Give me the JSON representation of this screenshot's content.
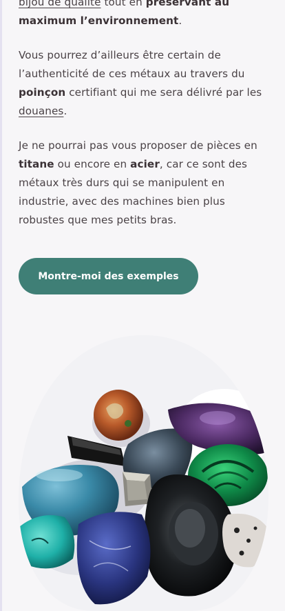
{
  "article": {
    "p1": {
      "link1": "bijou de qualité",
      "t1": " tout en ",
      "b1": "préservant au maximum l’environnement",
      "t2": "."
    },
    "p2": {
      "t1": "Vous pourrez d’ailleurs être certain de l’authenticité de ces métaux au travers du ",
      "b1": "poinçon",
      "t2": " certifiant qui me sera délivré par les ",
      "link1": "douanes",
      "t3": "."
    },
    "p3": {
      "t1": "Je ne pourrai pas vous proposer de pièces en ",
      "b1": "titane",
      "t2": " ou encore en ",
      "b2": "acier",
      "t3": ", car ce sont des métaux très durs qui se manipulent en industrie, avec des machines bien plus robustes que mes petits bras."
    }
  },
  "cta": {
    "label": "Montre-moi des exemples"
  },
  "colors": {
    "background": "#f7f6f8",
    "text": "#4a4246",
    "button": "#3f7f76",
    "button_text": "#ffffff"
  },
  "icons": {
    "photo": "gemstones-photo"
  }
}
